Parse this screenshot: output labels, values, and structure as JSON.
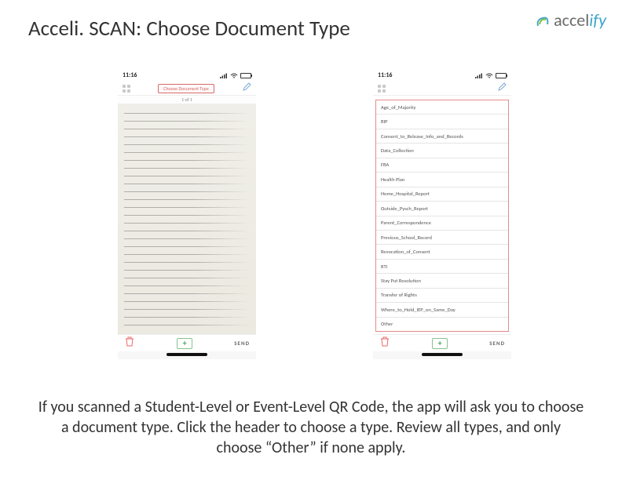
{
  "title": "Acceli. SCAN: Choose Document Type",
  "logo": {
    "brand_part1": "accel",
    "brand_part2": "ify"
  },
  "status": {
    "time": "11:16"
  },
  "left_phone": {
    "header_chip": "Choose Document Type",
    "page_indicator": "1 of 1"
  },
  "right_phone": {
    "items": [
      "Age_of_Majority",
      "BIP",
      "Consent_to_Release_Info_and_Records",
      "Data_Collection",
      "FBA",
      "Health Plan",
      "Home_Hospital_Report",
      "Outside_Pysch_Report",
      "Parent_Correspondence",
      "Previous_School_Record",
      "Revocation_of_Consent",
      "RTI",
      "Stay Put Resolution",
      "Transfer of Rights",
      "Where_to_Hold_IEP_on_Same_Day",
      "Other"
    ]
  },
  "bottom": {
    "send_label": "SEND",
    "add_glyph": "+"
  },
  "caption": "If you scanned a Student-Level or Event-Level QR Code, the app will ask you to choose a document type. Click the header to choose a type. Review all types, and only choose “Other” if none apply."
}
